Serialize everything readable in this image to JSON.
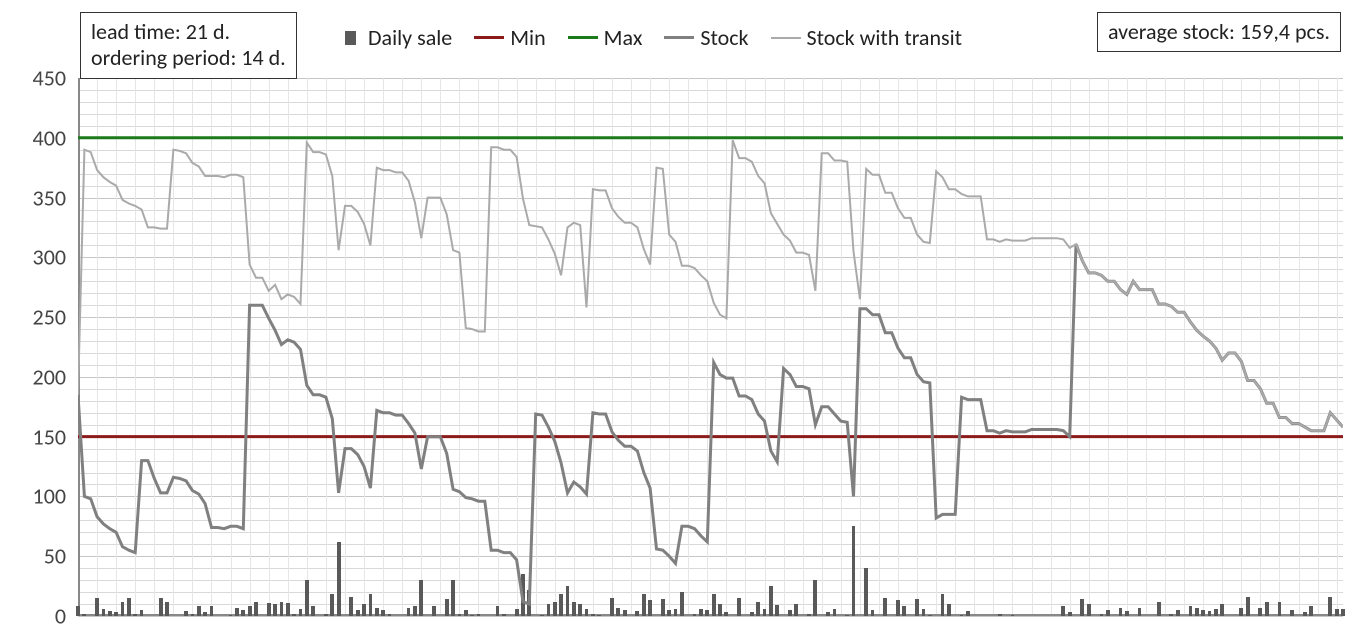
{
  "info_left_line1": "lead time: 21 d.",
  "info_left_line2": "ordering period: 14 d.",
  "info_right_line1": "average stock: 159,4 pcs.",
  "chart_data": {
    "type": "line+bar",
    "ylim": [
      0,
      450
    ],
    "y_major_step": 50,
    "y_minor_intervals": 5,
    "title": "",
    "xlabel": "",
    "ylabel": "",
    "constant_lines": {
      "Min": 150,
      "Max": 400
    },
    "series": [
      {
        "name": "Daily sale",
        "type": "bar",
        "color": "#595959",
        "values": [
          8,
          2,
          0,
          15,
          6,
          4,
          3,
          12,
          15,
          2,
          5,
          0,
          0,
          15,
          12,
          0,
          0,
          4,
          2,
          8,
          3,
          8,
          0,
          0,
          1,
          7,
          5,
          8,
          12,
          0,
          11,
          10,
          12,
          11,
          2,
          6,
          30,
          8,
          0,
          2,
          18,
          62,
          0,
          16,
          5,
          10,
          18,
          7,
          5,
          2,
          0,
          0,
          7,
          8,
          30,
          0,
          8,
          0,
          14,
          30,
          2,
          5,
          1,
          2,
          0,
          0,
          8,
          2,
          0,
          6,
          35,
          22,
          0,
          1,
          10,
          12,
          18,
          25,
          12,
          10,
          6,
          2,
          1,
          0,
          15,
          7,
          5,
          0,
          4,
          18,
          13,
          0,
          14,
          5,
          6,
          20,
          0,
          2,
          6,
          5,
          18,
          10,
          3,
          0,
          15,
          0,
          3,
          12,
          6,
          25,
          9,
          0,
          5,
          10,
          0,
          2,
          30,
          0,
          3,
          6,
          0,
          1,
          75,
          0,
          40,
          5,
          0,
          15,
          0,
          13,
          8,
          0,
          14,
          6,
          1,
          0,
          18,
          10,
          0,
          1,
          4,
          0,
          0,
          0,
          0,
          2,
          0,
          1,
          0,
          0,
          0,
          0,
          0,
          0,
          0,
          8,
          3,
          0,
          14,
          10,
          0,
          2,
          5,
          0,
          7,
          4,
          0,
          7,
          0,
          0,
          12,
          0,
          2,
          5,
          0,
          8,
          7,
          5,
          4,
          6,
          10,
          0,
          0,
          7,
          16,
          0,
          7,
          12,
          0,
          12,
          0,
          5,
          0,
          3,
          8,
          0,
          0,
          16,
          6,
          6
        ]
      },
      {
        "name": "Min",
        "type": "line",
        "color": "#8b1a1a",
        "width": 3,
        "constant": 150
      },
      {
        "name": "Max",
        "type": "line",
        "color": "#1b7a1b",
        "width": 3,
        "constant": 400
      },
      {
        "name": "Stock",
        "type": "line",
        "color": "#808080",
        "width": 3,
        "values": [
          185,
          100,
          98,
          83,
          77,
          73,
          70,
          58,
          55,
          53,
          130,
          130,
          115,
          103,
          103,
          116,
          115,
          113,
          105,
          102,
          94,
          74,
          74,
          73,
          75,
          75,
          73,
          260,
          260,
          260,
          249,
          239,
          227,
          231,
          229,
          223,
          193,
          185,
          185,
          183,
          165,
          103,
          140,
          140,
          135,
          125,
          107,
          172,
          170,
          170,
          168,
          168,
          161,
          153,
          123,
          150,
          150,
          150,
          136,
          106,
          104,
          99,
          98,
          96,
          96,
          55,
          55,
          53,
          53,
          47,
          12,
          10,
          169,
          168,
          158,
          146,
          128,
          103,
          112,
          108,
          102,
          170,
          169,
          169,
          154,
          147,
          142,
          142,
          138,
          120,
          107,
          56,
          55,
          50,
          44,
          75,
          75,
          73,
          67,
          62,
          212,
          202,
          199,
          199,
          184,
          184,
          181,
          169,
          163,
          138,
          129,
          207,
          202,
          192,
          192,
          190,
          160,
          175,
          175,
          169,
          163,
          162,
          100,
          257,
          257,
          252,
          252,
          237,
          237,
          224,
          216,
          216,
          202,
          196,
          195,
          82,
          85,
          85,
          85,
          183,
          181,
          181,
          181,
          155,
          155,
          153,
          155,
          154,
          154,
          154,
          156,
          156,
          156,
          156,
          156,
          155,
          150,
          311,
          297,
          287,
          287,
          285,
          280,
          280,
          273,
          269,
          280,
          273,
          273,
          273,
          261,
          261,
          259,
          254,
          254,
          246,
          239,
          234,
          230,
          224,
          214,
          220,
          220,
          213,
          197,
          197,
          190,
          178,
          178,
          166,
          166,
          161,
          161,
          158,
          155,
          155,
          155,
          170,
          164,
          158
        ]
      },
      {
        "name": "Stock with transit",
        "type": "line",
        "color": "#aaaaaa",
        "width": 2,
        "values": [
          185,
          390,
          388,
          373,
          367,
          363,
          360,
          348,
          345,
          343,
          340,
          325,
          325,
          324,
          324,
          390,
          389,
          387,
          379,
          376,
          368,
          368,
          368,
          367,
          369,
          369,
          367,
          294,
          283,
          283,
          272,
          277,
          265,
          269,
          267,
          261,
          396,
          388,
          388,
          386,
          368,
          306,
          343,
          343,
          338,
          328,
          310,
          375,
          373,
          373,
          371,
          371,
          364,
          346,
          316,
          350,
          350,
          350,
          336,
          306,
          304,
          241,
          240,
          238,
          238,
          392,
          392,
          390,
          390,
          384,
          349,
          327,
          326,
          325,
          315,
          303,
          285,
          325,
          329,
          327,
          258,
          357,
          356,
          356,
          341,
          334,
          329,
          329,
          325,
          307,
          294,
          375,
          374,
          319,
          313,
          293,
          293,
          291,
          285,
          280,
          262,
          252,
          249,
          398,
          383,
          383,
          380,
          368,
          362,
          337,
          328,
          319,
          314,
          304,
          304,
          302,
          272,
          387,
          387,
          381,
          381,
          380,
          305,
          265,
          374,
          369,
          369,
          354,
          354,
          341,
          333,
          333,
          319,
          313,
          312,
          372,
          367,
          357,
          357,
          353,
          351,
          351,
          351,
          315,
          315,
          313,
          315,
          314,
          314,
          314,
          316,
          316,
          316,
          316,
          316,
          315,
          308,
          311,
          297,
          287,
          287,
          285,
          280,
          280,
          273,
          269,
          280,
          273,
          273,
          273,
          261,
          261,
          259,
          254,
          254,
          246,
          239,
          234,
          230,
          224,
          214,
          220,
          220,
          213,
          197,
          197,
          190,
          178,
          178,
          166,
          166,
          161,
          161,
          158,
          155,
          155,
          155,
          170,
          164,
          158
        ]
      }
    ],
    "legend_labels": [
      "Daily sale",
      "Min",
      "Max",
      "Stock",
      "Stock with transit"
    ]
  }
}
